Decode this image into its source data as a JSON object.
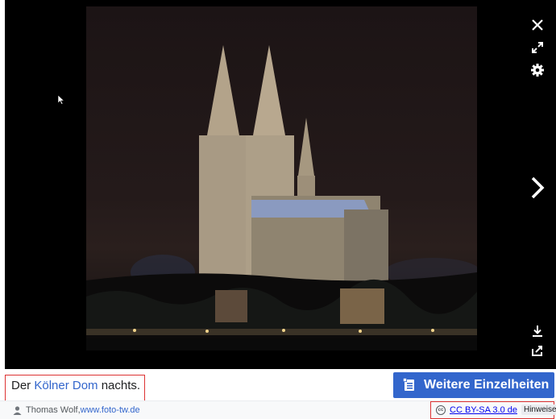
{
  "viewer": {
    "image_alt": "Kölner Dom bei Nacht",
    "controls": {
      "close": "close-icon",
      "fullscreen": "fullscreen-icon",
      "settings": "gear-icon",
      "next": "chevron-right-icon",
      "download": "download-icon",
      "share": "share-icon"
    }
  },
  "caption": {
    "prefix": "Der ",
    "link": "Kölner Dom",
    "suffix": " nachts."
  },
  "author": {
    "name": "Thomas Wolf, ",
    "link": "www.foto-tw.de"
  },
  "details_button": {
    "label": "Weitere Einzelheiten"
  },
  "license": {
    "cc_glyph": "cc",
    "label": "CC BY-SA 3.0 de",
    "hint_label": "Hinweise"
  },
  "colors": {
    "accent": "#3366cc",
    "highlight_border": "#dd3333",
    "viewer_bg": "#000000"
  }
}
